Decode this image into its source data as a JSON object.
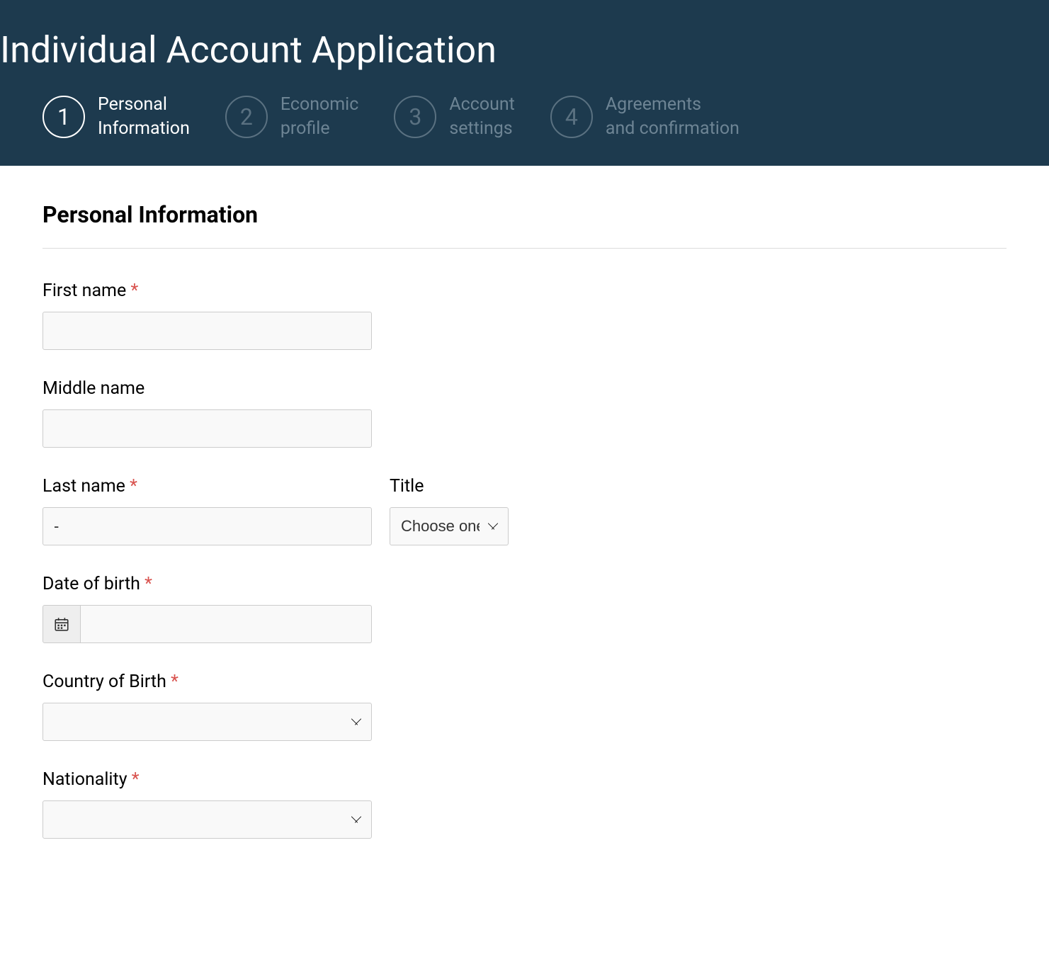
{
  "header": {
    "title": "Individual Account Application",
    "steps": [
      {
        "num": "1",
        "line1": "Personal",
        "line2": "Information",
        "active": true
      },
      {
        "num": "2",
        "line1": "Economic",
        "line2": "profile",
        "active": false
      },
      {
        "num": "3",
        "line1": "Account",
        "line2": "settings",
        "active": false
      },
      {
        "num": "4",
        "line1": "Agreements",
        "line2": "and confirmation",
        "active": false
      }
    ]
  },
  "section": {
    "title": "Personal Information"
  },
  "fields": {
    "first_name": {
      "label": "First name",
      "required": "*",
      "value": ""
    },
    "middle_name": {
      "label": "Middle name",
      "value": ""
    },
    "last_name": {
      "label": "Last name",
      "required": "*",
      "value": "-"
    },
    "title_field": {
      "label": "Title",
      "selected": "Choose one"
    },
    "dob": {
      "label": "Date of birth",
      "required": "*",
      "value": ""
    },
    "country_birth": {
      "label": "Country of Birth",
      "required": "*",
      "selected": ""
    },
    "nationality": {
      "label": "Nationality",
      "required": "*",
      "selected": ""
    }
  }
}
